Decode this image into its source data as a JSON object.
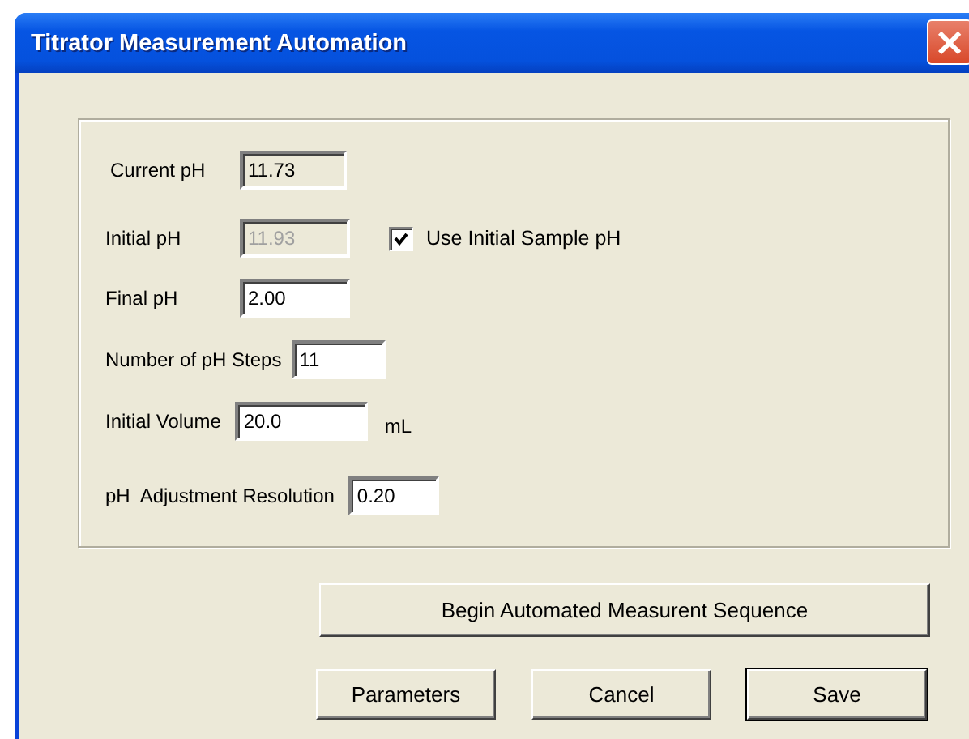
{
  "window": {
    "title": "Titrator Measurement Automation",
    "close_glyph": "×"
  },
  "fields": [
    {
      "label": "Current pH",
      "value": "11.73",
      "kind": "display"
    },
    {
      "label": "Initial pH",
      "value": "11.93",
      "kind": "disabled",
      "checkbox": {
        "label": "Use Initial Sample pH",
        "checked": true
      }
    },
    {
      "label": "Final pH",
      "value": "2.00",
      "kind": "input"
    },
    {
      "label": "Number of pH Steps",
      "value": "11",
      "kind": "input"
    },
    {
      "label": "Initial Volume",
      "value": "20.0",
      "kind": "input",
      "unit": "mL"
    },
    {
      "label": "pH  Adjustment Resolution",
      "value": "0.20",
      "kind": "input"
    }
  ],
  "main_button": {
    "label": "Begin Automated Measurent Sequence"
  },
  "buttons": [
    {
      "label": "Parameters",
      "default": false
    },
    {
      "label": "Cancel",
      "default": false
    },
    {
      "label": "Save",
      "default": true
    }
  ]
}
